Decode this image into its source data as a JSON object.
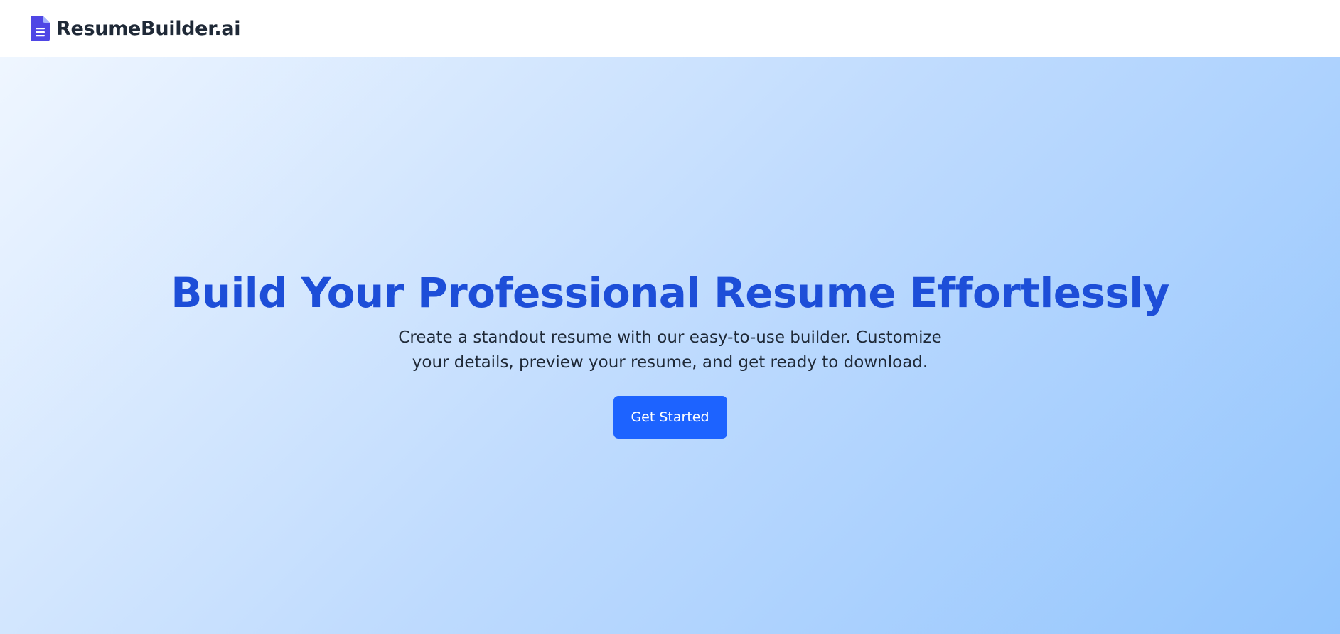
{
  "navbar": {
    "brand_name": "ResumeBuilder.ai",
    "brand_icon": "document-icon",
    "brand_icon_color": "#4f46e5"
  },
  "hero": {
    "title": "Build Your Professional Resume Effortlessly",
    "subtitle": "Create a standout resume with our easy-to-use builder. Customize your details, preview your resume, and get ready to download.",
    "cta_label": "Get Started"
  },
  "colors": {
    "title": "#1d4ed8",
    "cta_background": "#1d63ff",
    "gradient_start": "#eff6ff",
    "gradient_end": "#93c5fd"
  }
}
